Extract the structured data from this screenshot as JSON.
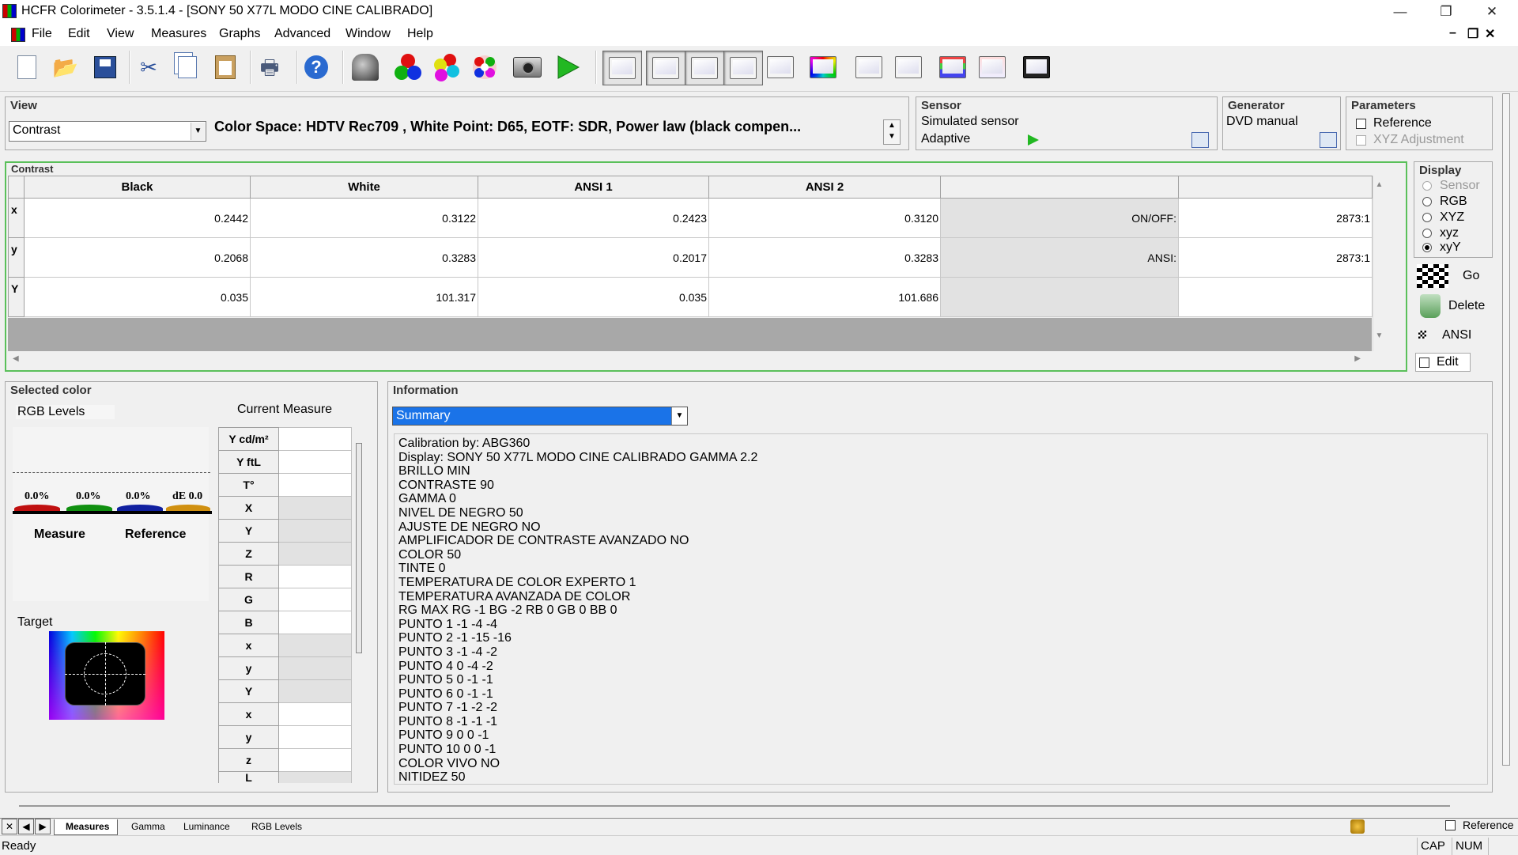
{
  "window": {
    "title": "HCFR Colorimeter - 3.5.1.4 - [SONY 50 X77L MODO CINE CALIBRADO]",
    "minimize": "—",
    "restore": "❐",
    "close": "✕"
  },
  "menu": {
    "items": [
      "File",
      "Edit",
      "View",
      "Measures",
      "Graphs",
      "Advanced",
      "Window",
      "Help"
    ],
    "mdi_minimize": "–",
    "mdi_restore": "❐",
    "mdi_close": "✕"
  },
  "toolbar": {
    "icons": [
      "new-icon",
      "open-icon",
      "save-icon",
      "cut-icon",
      "copy-icon",
      "paste-icon",
      "print-icon",
      "help-icon",
      "sensor-icon",
      "primaries-icon",
      "secondaries-icon",
      "saturation-icon",
      "camera-icon",
      "play-icon",
      "view-monitor-1-icon",
      "view-monitor-2-icon",
      "view-monitor-3-icon",
      "view-monitor-4-icon",
      "view-monitor-5-icon",
      "cie-chart-icon",
      "view-monitor-7-icon",
      "view-monitor-8-icon",
      "rgb-levels-icon",
      "gamma-curve-icon",
      "film-icon"
    ]
  },
  "view_panel": {
    "title": "View",
    "selected": "Contrast",
    "description": "Color Space: HDTV Rec709 , White Point: D65, EOTF:  SDR, Power law (black compen..."
  },
  "sensor_panel": {
    "title": "Sensor",
    "name": "Simulated sensor",
    "mode": "Adaptive"
  },
  "generator_panel": {
    "title": "Generator",
    "name": "DVD manual"
  },
  "parameters_panel": {
    "title": "Parameters",
    "reference_label": "Reference",
    "xyz_adjustment_label": "XYZ Adjustment"
  },
  "contrast_grid": {
    "title": "Contrast",
    "columns": [
      "Black",
      "White",
      "ANSI 1",
      "ANSI 2",
      "",
      ""
    ],
    "rows": [
      {
        "label": "x",
        "values": [
          "0.2442",
          "0.3122",
          "0.2423",
          "0.3120",
          "ON/OFF:",
          "2873:1"
        ]
      },
      {
        "label": "y",
        "values": [
          "0.2068",
          "0.3283",
          "0.2017",
          "0.3283",
          "ANSI:",
          "2873:1"
        ]
      },
      {
        "label": "Y",
        "values": [
          "0.035",
          "101.317",
          "0.035",
          "101.686",
          "",
          ""
        ]
      }
    ]
  },
  "display_panel": {
    "title": "Display",
    "options": [
      "Sensor",
      "RGB",
      "XYZ",
      "xyz",
      "xyY"
    ],
    "selected": "xyY",
    "go_label": "Go",
    "delete_label": "Delete",
    "ansi_label": "ANSI",
    "edit_label": "Edit"
  },
  "selected_color": {
    "title": "Selected color",
    "rgb_levels_label": "RGB Levels",
    "current_measure_label": "Current Measure",
    "r_percent": "0.0%",
    "g_percent": "0.0%",
    "b_percent": "0.0%",
    "de_label": "dE 0.0",
    "measure_label": "Measure",
    "reference_label": "Reference",
    "target_label": "Target",
    "measure_rows": [
      "Y cd/m²",
      "Y ftL",
      "T°",
      "X",
      "Y",
      "Z",
      "R",
      "G",
      "B",
      "x",
      "y",
      "Y",
      "x",
      "y",
      "z",
      "L"
    ]
  },
  "information": {
    "title": "Information",
    "selected": "Summary",
    "lines": [
      "Calibration by: ABG360",
      "Display: SONY 50 X77L MODO CINE CALIBRADO GAMMA 2.2",
      "BRILLO MIN",
      "CONTRASTE 90",
      "GAMMA 0",
      "NIVEL DE NEGRO 50",
      "AJUSTE DE NEGRO NO",
      "AMPLIFICADOR DE CONTRASTE AVANZADO NO",
      "COLOR 50",
      "TINTE 0",
      "TEMPERATURA DE COLOR EXPERTO 1",
      "TEMPERATURA AVANZADA DE COLOR",
      "RG MAX RG -1 BG -2 RB 0 GB 0 BB 0",
      "PUNTO 1 -1 -4 -4",
      "PUNTO 2 -1 -15 -16",
      "PUNTO 3 -1 -4 -2",
      "PUNTO 4 0 -4 -2",
      "PUNTO 5 0 -1 -1",
      "PUNTO 6 0 -1 -1",
      "PUNTO 7 -1 -2 -2",
      "PUNTO 8 -1 -1 -1",
      "PUNTO 9 0 0 -1",
      "PUNTO 10 0 0 -1",
      "COLOR VIVO NO",
      "NITIDEZ 50"
    ]
  },
  "bottom_tabs": {
    "nav": [
      "✕",
      "◀",
      "▶"
    ],
    "tabs": [
      "Measures",
      "Gamma",
      "Luminance",
      "RGB Levels"
    ],
    "active": "Measures",
    "reference_label": "Reference"
  },
  "status_bar": {
    "text": "Ready",
    "cap": "CAP",
    "num": "NUM"
  }
}
